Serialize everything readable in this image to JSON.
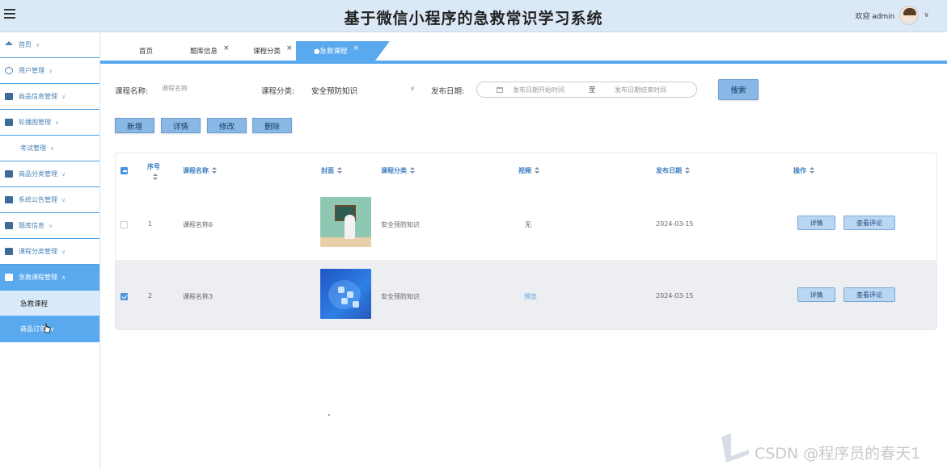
{
  "header": {
    "title": "基于微信小程序的急救常识学习系统",
    "welcome": "欢迎 admin",
    "caret": "∨"
  },
  "sidebar": {
    "items": [
      {
        "label": "首页",
        "caret": "∨"
      },
      {
        "label": "用户管理",
        "caret": "∨"
      },
      {
        "label": "商品信息管理",
        "caret": "∨"
      },
      {
        "label": "轮播图管理",
        "caret": "∨"
      },
      {
        "label": "考试管理",
        "caret": "∨"
      },
      {
        "label": "商品分类管理",
        "caret": "∨"
      },
      {
        "label": "系统公告管理",
        "caret": "∨"
      },
      {
        "label": "题库信息",
        "caret": "∨"
      },
      {
        "label": "课程分类管理",
        "caret": "∨"
      },
      {
        "label": "急救课程管理",
        "caret": "∧"
      },
      {
        "label": "急救课程"
      },
      {
        "label": "商品订单",
        "caret": "∨"
      }
    ]
  },
  "tabs": [
    {
      "label": "首页"
    },
    {
      "label": "题库信息",
      "close": "×"
    },
    {
      "label": "课程分类",
      "close": "×"
    },
    {
      "label": "●急救课程",
      "close": "×"
    }
  ],
  "search": {
    "name_label": "课程名称:",
    "name_placeholder": "课程名称",
    "category_label": "课程分类:",
    "category_value": "安全预防知识",
    "category_caret": "∨",
    "date_label": "发布日期:",
    "date_start_placeholder": "发布日期开始时间",
    "date_separator": "至",
    "date_end_placeholder": "发布日期结束时间",
    "search_button": "搜索"
  },
  "actions": {
    "add": "新增",
    "detail": "详情",
    "edit": "修改",
    "delete": "删除"
  },
  "table": {
    "headers": {
      "index": "序号",
      "name": "课程名称",
      "cover": "封面",
      "category": "课程分类",
      "video": "视频",
      "date": "发布日期",
      "ops": "操作"
    },
    "rows": [
      {
        "index": "1",
        "name": "课程名称6",
        "category": "安全预防知识",
        "video": "无",
        "date": "2024-03-15",
        "detail": "详情",
        "comments": "查看评论",
        "checked": false
      },
      {
        "index": "2",
        "name": "课程名称3",
        "category": "安全预防知识",
        "video": "预览",
        "date": "2024-03-15",
        "detail": "详情",
        "comments": "查看评论",
        "checked": true
      }
    ]
  },
  "watermark": "CSDN @程序员的春天1",
  "colors": {
    "accent": "#5aa9ee",
    "header_bg": "#dbe9f7",
    "button": "#8ab8e6"
  }
}
